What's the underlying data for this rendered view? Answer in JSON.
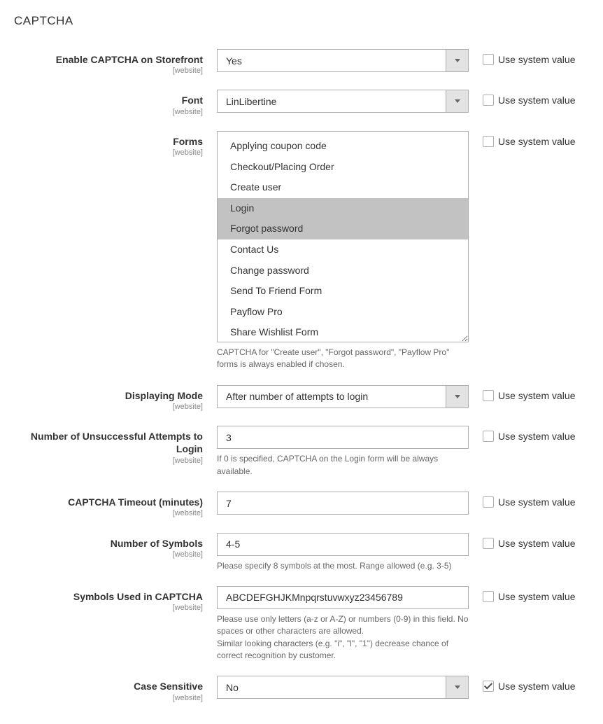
{
  "section_title": "CAPTCHA",
  "scope_label_text": "[website]",
  "use_system_value_label": "Use system value",
  "fields": {
    "enable": {
      "label": "Enable CAPTCHA on Storefront",
      "value": "Yes",
      "use_system": false
    },
    "font": {
      "label": "Font",
      "value": "LinLibertine",
      "use_system": false
    },
    "forms": {
      "label": "Forms",
      "options": [
        {
          "text": "Applying coupon code",
          "selected": false
        },
        {
          "text": "Checkout/Placing Order",
          "selected": false
        },
        {
          "text": "Create user",
          "selected": false
        },
        {
          "text": "Login",
          "selected": true
        },
        {
          "text": "Forgot password",
          "selected": true
        },
        {
          "text": "Contact Us",
          "selected": false
        },
        {
          "text": "Change password",
          "selected": false
        },
        {
          "text": "Send To Friend Form",
          "selected": false
        },
        {
          "text": "Payflow Pro",
          "selected": false
        },
        {
          "text": "Share Wishlist Form",
          "selected": false
        }
      ],
      "note": "CAPTCHA for \"Create user\", \"Forgot password\", \"Payflow Pro\" forms is always enabled if chosen.",
      "use_system": false
    },
    "displaying_mode": {
      "label": "Displaying Mode",
      "value": "After number of attempts to login",
      "use_system": false
    },
    "attempts": {
      "label": "Number of Unsuccessful Attempts to Login",
      "value": "3",
      "note": "If 0 is specified, CAPTCHA on the Login form will be always available.",
      "use_system": false
    },
    "timeout": {
      "label": "CAPTCHA Timeout (minutes)",
      "value": "7",
      "use_system": false
    },
    "symbols_count": {
      "label": "Number of Symbols",
      "value": "4-5",
      "note": "Please specify 8 symbols at the most. Range allowed (e.g. 3-5)",
      "use_system": false
    },
    "symbols": {
      "label": "Symbols Used in CAPTCHA",
      "value": "ABCDEFGHJKMnpqrstuvwxyz23456789",
      "note": "Please use only letters (a-z or A-Z) or numbers (0-9) in this field. No spaces or other characters are allowed.\nSimilar looking characters (e.g. \"i\", \"l\", \"1\") decrease chance of correct recognition by customer.",
      "use_system": false
    },
    "case_sensitive": {
      "label": "Case Sensitive",
      "value": "No",
      "use_system": true
    }
  }
}
